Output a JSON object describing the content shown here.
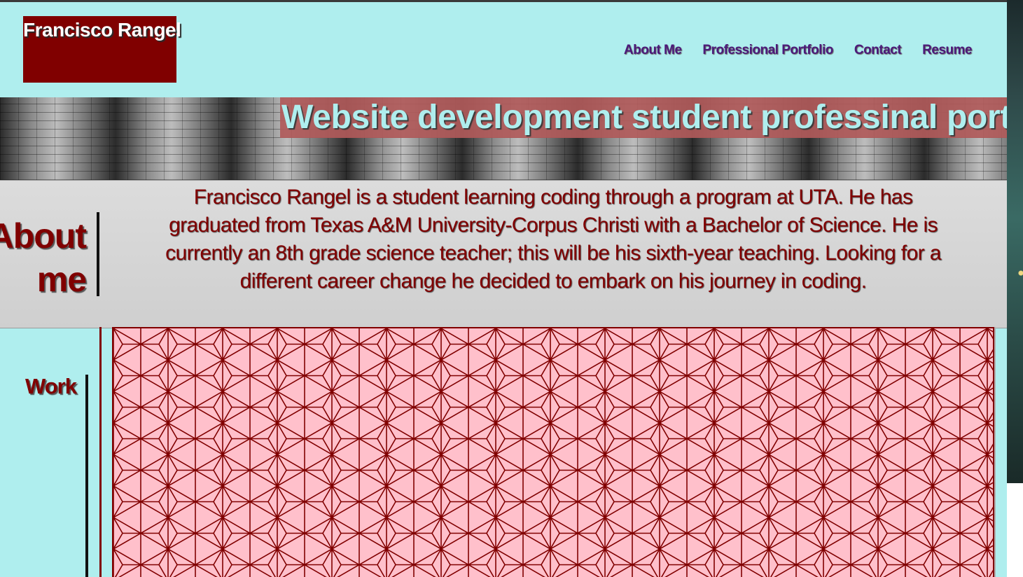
{
  "brand": {
    "name": "Francisco Rangel"
  },
  "nav": {
    "items": [
      {
        "label": "About Me"
      },
      {
        "label": "Professional Portfolio"
      },
      {
        "label": "Contact"
      },
      {
        "label": "Resume"
      }
    ]
  },
  "hero": {
    "title": "Website development student professinal portfolio"
  },
  "about": {
    "heading_line1": "About",
    "heading_line2": "me",
    "text": "Francisco Rangel is a student learning coding through a program at UTA. He has graduated from Texas A&M University-Corpus Christi with a Bachelor of Science. He is currently an 8th grade science teacher; this will be his sixth-year teaching. Looking for a different career change he decided to embark on his journey in coding."
  },
  "work": {
    "heading": "Work"
  },
  "colors": {
    "page_background": "#afeeee",
    "accent": "#800000",
    "nav_link": "#4b1a7a",
    "hero_title_background": "#b05a5a",
    "work_panel_background": "#ffc0cb"
  },
  "icons": {
    "work_pattern": "asanoha-pattern"
  }
}
